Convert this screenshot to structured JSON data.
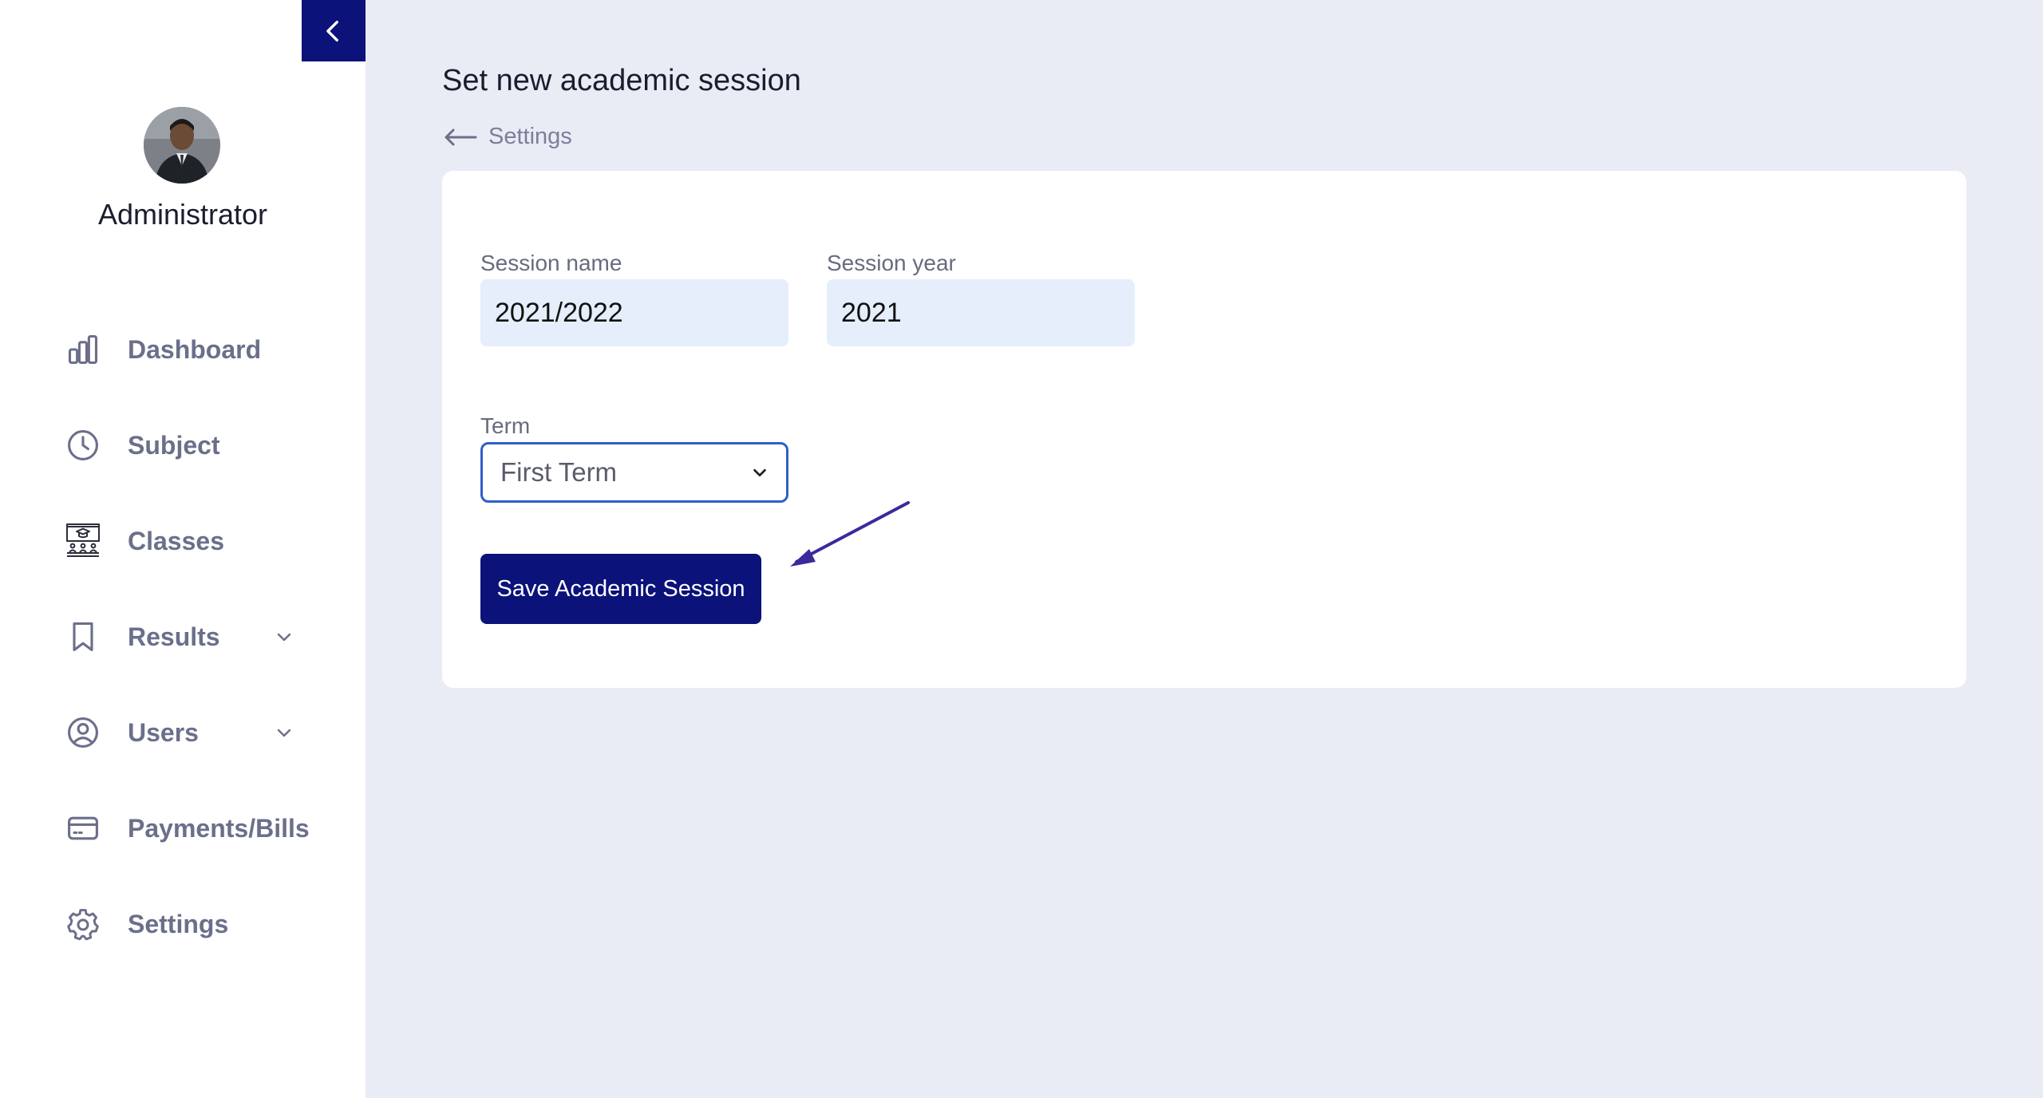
{
  "sidebar": {
    "admin_name": "Administrator",
    "items": [
      {
        "label": "Dashboard",
        "icon": "bar-chart-icon"
      },
      {
        "label": "Subject",
        "icon": "clock-icon"
      },
      {
        "label": "Classes",
        "icon": "classroom-icon"
      },
      {
        "label": "Results",
        "icon": "bookmark-icon",
        "expandable": true
      },
      {
        "label": "Users",
        "icon": "user-circle-icon",
        "expandable": true
      },
      {
        "label": "Payments/Bills",
        "icon": "credit-card-icon"
      },
      {
        "label": "Settings",
        "icon": "gear-icon"
      }
    ]
  },
  "header": {
    "title": "Set new academic session",
    "back_label": "Settings"
  },
  "form": {
    "session_name_label": "Session name",
    "session_name_value": "2021/2022",
    "session_year_label": "Session year",
    "session_year_value": "2021",
    "term_label": "Term",
    "term_value": "First Term",
    "save_label": "Save Academic Session"
  },
  "colors": {
    "brand": "#0b127a",
    "background": "#e9ecf5",
    "input_bg": "#e6eefc",
    "annotation_arrow": "#3b2a9c"
  }
}
